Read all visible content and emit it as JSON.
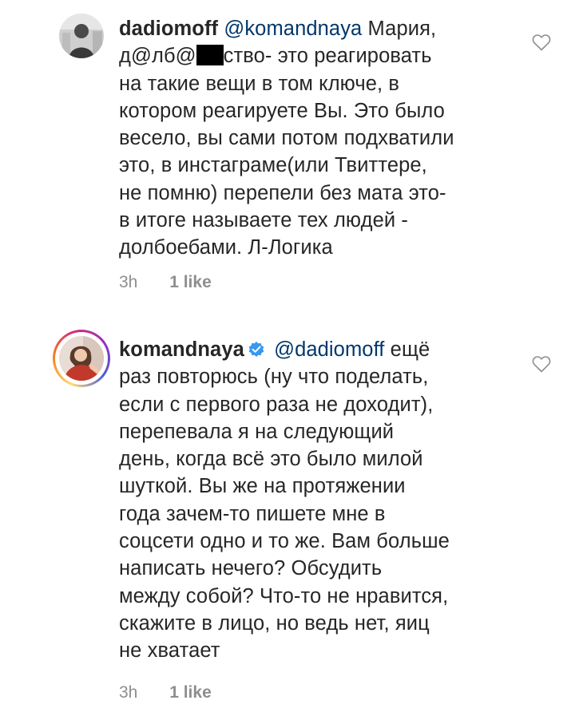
{
  "comments": [
    {
      "username": "dadiomoff",
      "mention": "@komandnaya",
      "text_line1_after_mention": " Мария,",
      "text_line2_before_censor": "д@лб@",
      "text_line2_after_censor": "ство- это реагировать",
      "lines": [
        "на такие вещи в том ключе, в",
        "котором реагируете Вы. Это было",
        "весело, вы сами потом подхватили",
        "это, в инстаграме(или Твиттере,",
        "не помню) перепели без мата это-",
        "в итоге называете тех людей -",
        "долбоебами. Л-Логика"
      ],
      "time": "3h",
      "likes": "1 like"
    },
    {
      "username": "komandnaya",
      "verified": true,
      "mention": "@dadiomoff",
      "text_line1_after_mention": " ещё",
      "lines": [
        "раз повторюсь (ну что поделать,",
        "если с первого раза не доходит),",
        "перепевала я на следующий",
        "день, когда всё это было милой",
        "шуткой. Вы же на протяжении",
        "года зачем-то пишете мне в",
        "соцсети одно и то же. Вам больше",
        "написать нечего? Обсудить",
        "между собой? Что-то не нравится,",
        "скажите в лицо, но ведь нет, яиц",
        "не хватает"
      ],
      "time": "3h",
      "likes": "1 like"
    }
  ],
  "icons": {
    "like": "heart-outline-icon",
    "verified": "verified-badge-icon"
  },
  "colors": {
    "text": "#262626",
    "mention": "#00376b",
    "meta": "#8e8e8e",
    "verified": "#3897f0"
  }
}
